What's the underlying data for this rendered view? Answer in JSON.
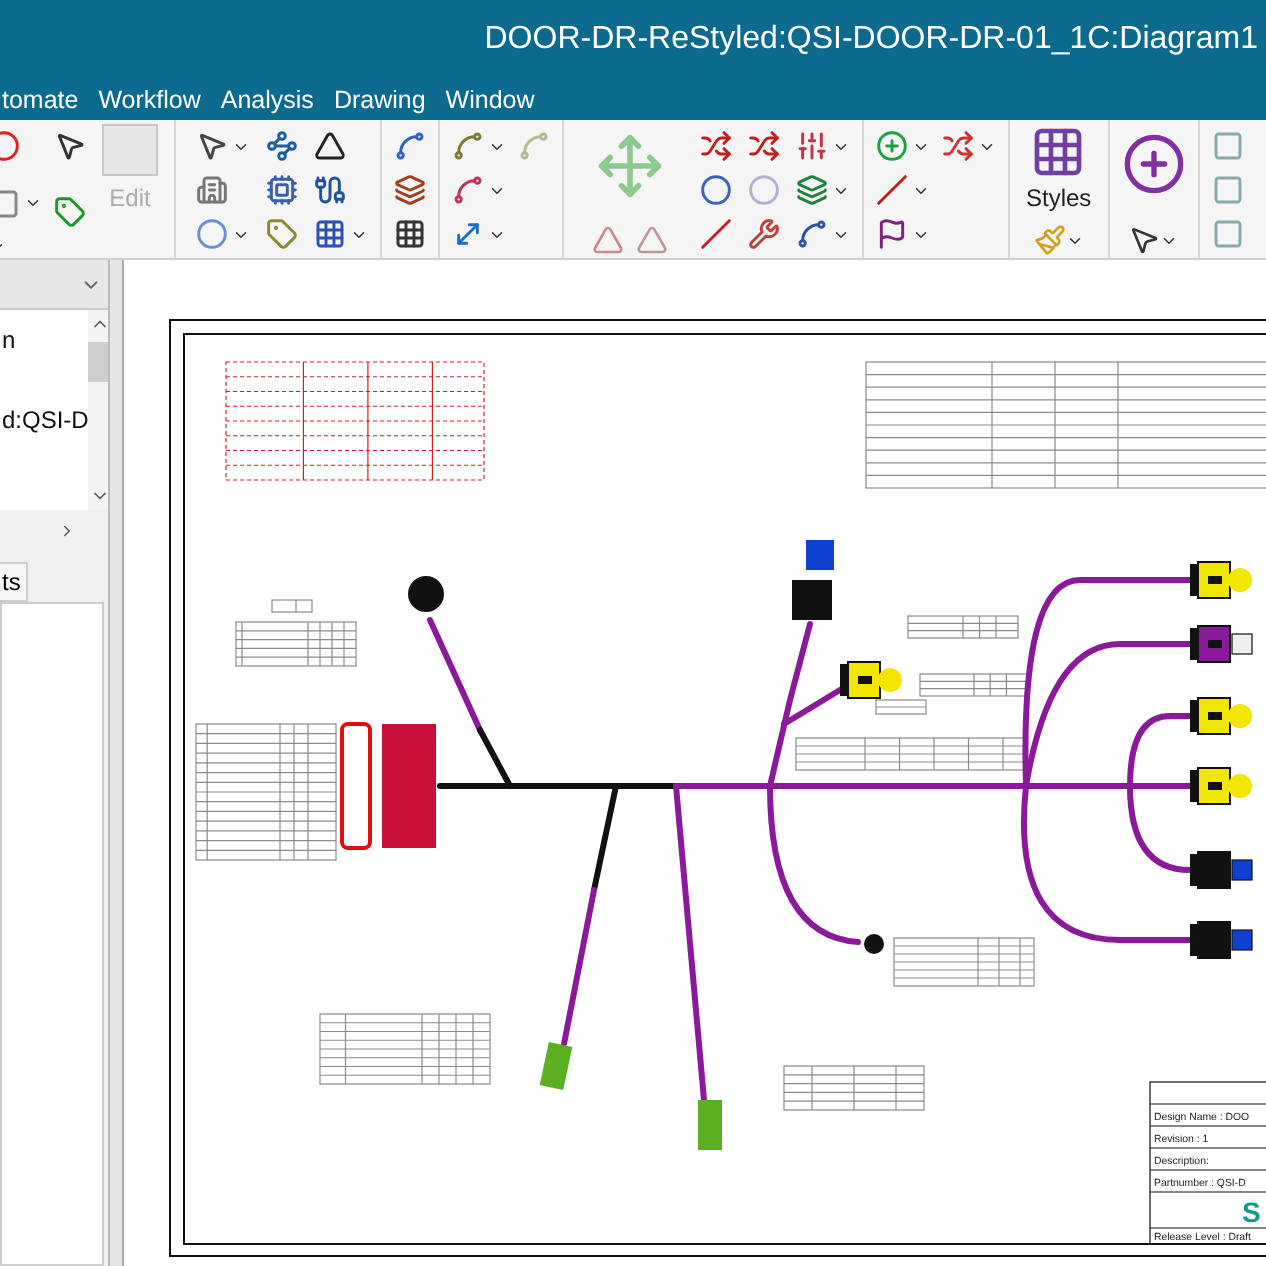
{
  "window": {
    "title": "DOOR-DR-ReStyled:QSI-DOOR-DR-01_1C:Diagram1"
  },
  "menu": [
    {
      "label": "tomate"
    },
    {
      "label": "Workflow"
    },
    {
      "label": "Analysis"
    },
    {
      "label": "Drawing"
    },
    {
      "label": "Window"
    }
  ],
  "toolbar": {
    "buttons": [
      {
        "kind": "edit",
        "label": "Edit",
        "disabled": true
      },
      {
        "kind": "styles",
        "label": "Styles",
        "disabled": false
      }
    ]
  },
  "left_panel": {
    "upper_items": [
      {
        "label": "n",
        "selected": false
      },
      {
        "label": "d:QSI-D",
        "selected": false
      }
    ],
    "lower_tab": {
      "label": "ts"
    }
  },
  "title_block": {
    "rows": [
      "Design Name : DOO",
      "Revision : 1",
      "Description:",
      "Partnumber : QSI-D"
    ],
    "logo": "S",
    "release": "Release Level : Draft"
  }
}
